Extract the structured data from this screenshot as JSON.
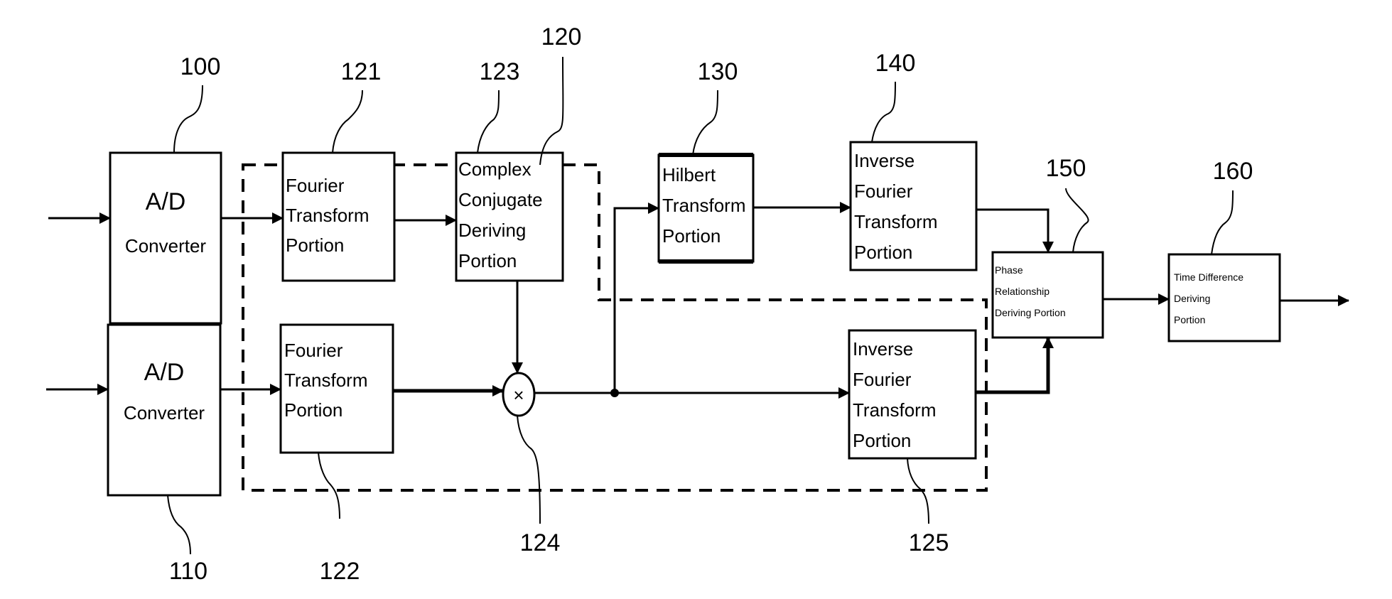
{
  "diagram": {
    "blocks": {
      "ad1": {
        "ref": "100",
        "line1": "A/D",
        "line2": "Converter"
      },
      "ad2": {
        "ref": "110",
        "line1": "A/D",
        "line2": "Converter"
      },
      "ft1": {
        "ref": "121",
        "lines": [
          "Fourier",
          "Transform",
          "Portion"
        ]
      },
      "ft2": {
        "ref": "122",
        "lines": [
          "Fourier",
          "Transform",
          "Portion"
        ]
      },
      "ccd": {
        "ref": "123",
        "lines": [
          "Complex",
          "Conjugate",
          "Deriving",
          "Portion"
        ]
      },
      "mult": {
        "ref": "124",
        "symbol": "×"
      },
      "ift2": {
        "ref": "125",
        "lines": [
          "Inverse",
          "Fourier",
          "Transform",
          "Portion"
        ]
      },
      "group": {
        "ref": "120"
      },
      "hilbert": {
        "ref": "130",
        "lines": [
          "Hilbert",
          "Transform",
          "Portion"
        ]
      },
      "ift1": {
        "ref": "140",
        "lines": [
          "Inverse",
          "Fourier",
          "Transform",
          "Portion"
        ]
      },
      "phase": {
        "ref": "150",
        "lines": [
          "Phase",
          "Relationship",
          "Deriving Portion"
        ]
      },
      "timediff": {
        "ref": "160",
        "lines": [
          "Time Difference",
          "Deriving",
          "Portion"
        ]
      }
    }
  }
}
